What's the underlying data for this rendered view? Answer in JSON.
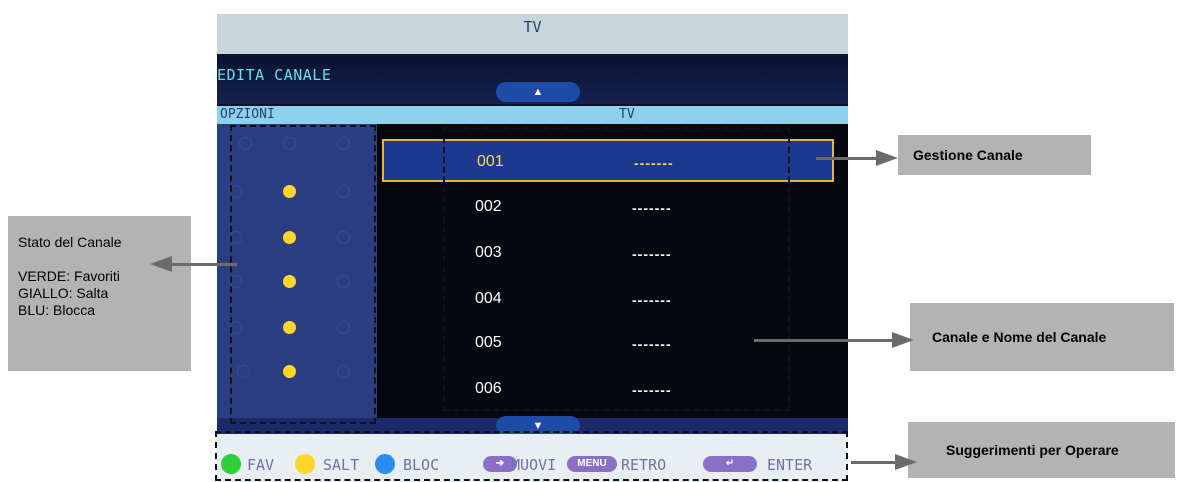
{
  "screen": {
    "top_title": "TV",
    "edit_title": "EDITA CANALE",
    "up_arrow": "▲",
    "down_arrow": "▼",
    "column_options": "OPZIONI",
    "column_tv": "TV"
  },
  "channels": [
    {
      "number": "001",
      "name": "-------",
      "selected": true
    },
    {
      "number": "002",
      "name": "-------",
      "selected": false
    },
    {
      "number": "003",
      "name": "-------",
      "selected": false
    },
    {
      "number": "004",
      "name": "-------",
      "selected": false
    },
    {
      "number": "005",
      "name": "-------",
      "selected": false
    },
    {
      "number": "006",
      "name": "-------",
      "selected": false
    }
  ],
  "hints": {
    "fav": "FAV",
    "salt": "SALT",
    "bloc": "BLOC",
    "muovi": "MUOVI",
    "menu_key": "MENU",
    "retro": "RETRO",
    "enter": "ENTER"
  },
  "annotations": {
    "stato_title": "Stato del Canale",
    "stato_verde": "VERDE: Favoriti",
    "stato_giallo": "GIALLO: Salta",
    "stato_blu": "BLU: Blocca",
    "gestione": "Gestione Canale",
    "canale_nome": "Canale e Nome del Canale",
    "suggerimenti": "Suggerimenti per Operare"
  },
  "colors": {
    "fav_green": "#2fcf3a",
    "salt_yellow": "#ffd628",
    "bloc_blue": "#2a8df0"
  }
}
